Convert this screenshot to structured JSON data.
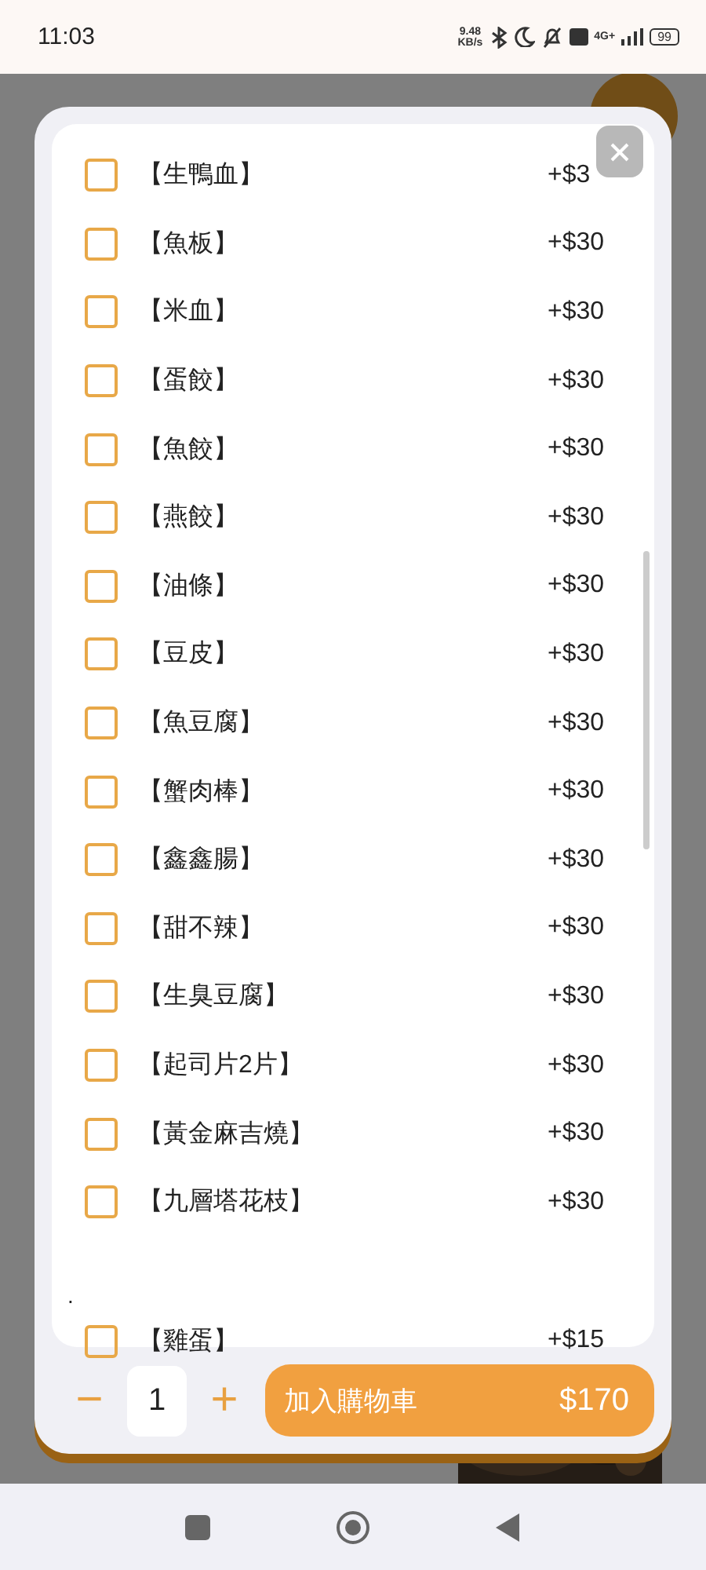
{
  "status_bar": {
    "time": "11:03",
    "speed": "9.48",
    "speed_unit": "KB/s",
    "network": "4G+",
    "battery": "99"
  },
  "options": [
    {
      "name": "【生鴨血】",
      "price": "+$3",
      "checked": false
    },
    {
      "name": "【魚板】",
      "price": "+$30",
      "checked": false
    },
    {
      "name": "【米血】",
      "price": "+$30",
      "checked": false
    },
    {
      "name": "【蛋餃】",
      "price": "+$30",
      "checked": false
    },
    {
      "name": "【魚餃】",
      "price": "+$30",
      "checked": false
    },
    {
      "name": "【燕餃】",
      "price": "+$30",
      "checked": false
    },
    {
      "name": "【油條】",
      "price": "+$30",
      "checked": false
    },
    {
      "name": "【豆皮】",
      "price": "+$30",
      "checked": false
    },
    {
      "name": "【魚豆腐】",
      "price": "+$30",
      "checked": false
    },
    {
      "name": "【蟹肉棒】",
      "price": "+$30",
      "checked": false
    },
    {
      "name": "【鑫鑫腸】",
      "price": "+$30",
      "checked": false
    },
    {
      "name": "【甜不辣】",
      "price": "+$30",
      "checked": false
    },
    {
      "name": "【生臭豆腐】",
      "price": "+$30",
      "checked": false
    },
    {
      "name": "【起司片2片】",
      "price": "+$30",
      "checked": false
    },
    {
      "name": "【黃金麻吉燒】",
      "price": "+$30",
      "checked": false
    },
    {
      "name": "【九層塔花枝】",
      "price": "+$30",
      "checked": false
    }
  ],
  "group_label": ".",
  "options_2": [
    {
      "name": "【雞蛋】",
      "price": "+$15",
      "checked": false
    }
  ],
  "quantity": {
    "minus": "−",
    "value": "1",
    "plus": "+"
  },
  "add_to_cart": {
    "label": "加入購物車",
    "total": "$170"
  }
}
